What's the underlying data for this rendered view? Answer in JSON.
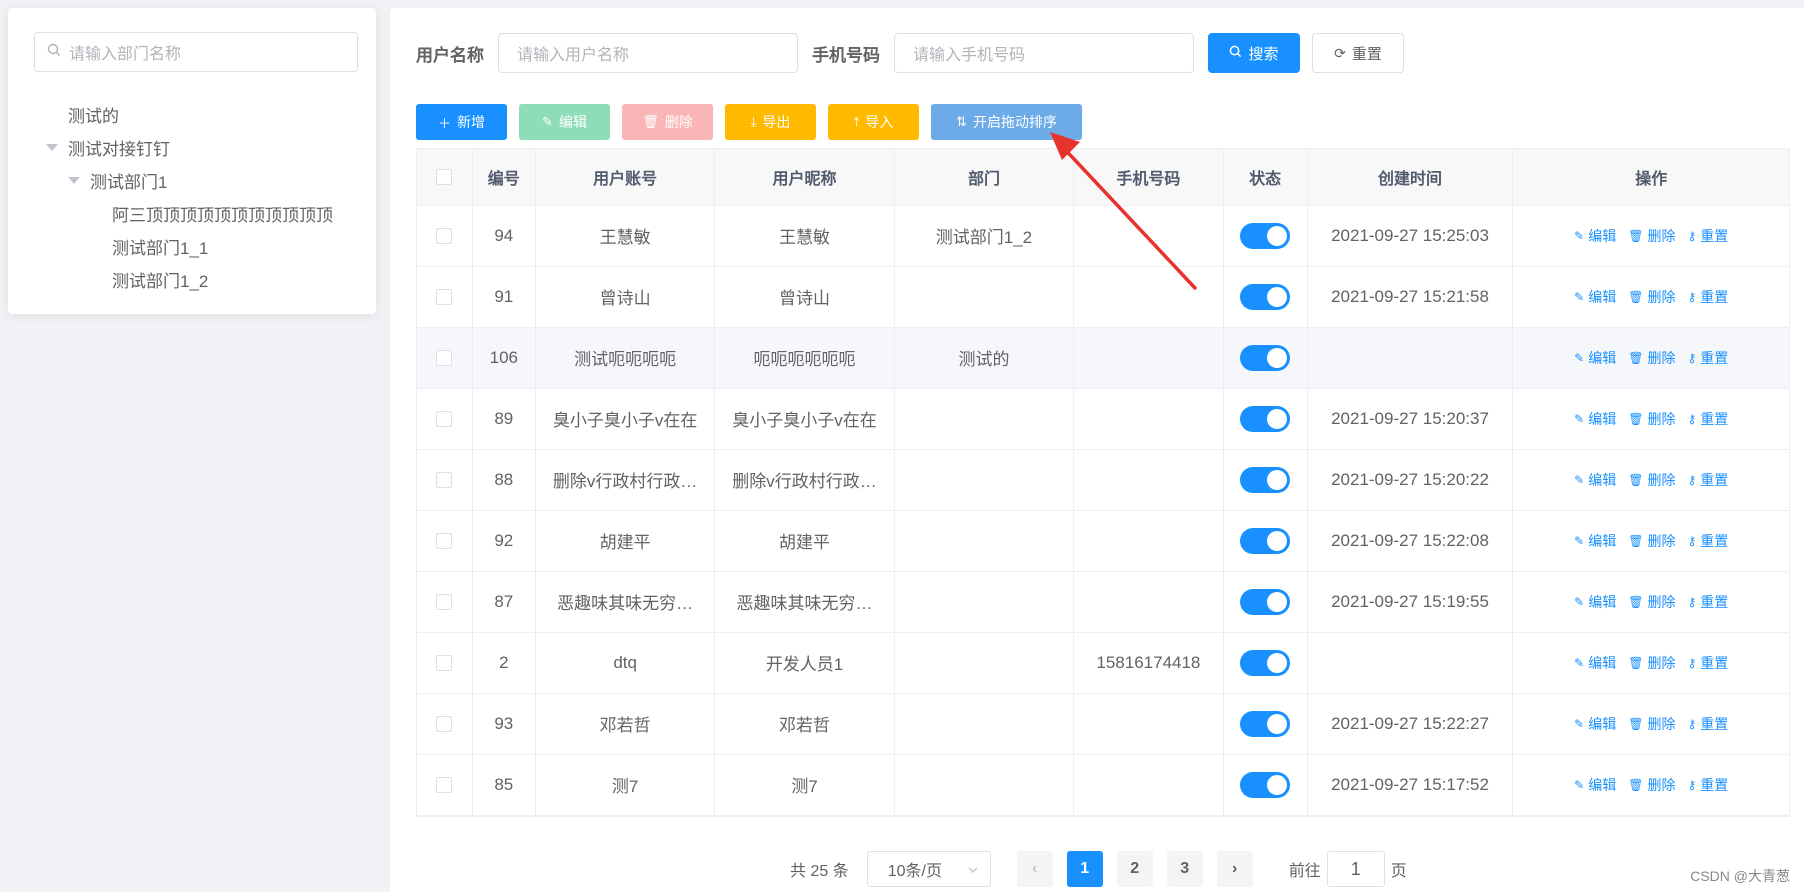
{
  "dept_panel": {
    "search_placeholder": "请输入部门名称",
    "tree": [
      {
        "label": "测试的",
        "level": 0,
        "expanded": false
      },
      {
        "label": "测试对接钉钉",
        "level": 0,
        "expanded": true
      },
      {
        "label": "测试部门1",
        "level": 1,
        "expanded": true
      },
      {
        "label": "阿三顶顶顶顶顶顶顶顶顶顶顶",
        "level": 2,
        "expanded": false
      },
      {
        "label": "测试部门1_1",
        "level": 2,
        "expanded": false
      },
      {
        "label": "测试部门1_2",
        "level": 2,
        "expanded": false
      }
    ]
  },
  "search_form": {
    "username_label": "用户名称",
    "username_placeholder": "请输入用户名称",
    "phone_label": "手机号码",
    "phone_placeholder": "请输入手机号码",
    "search_button": "搜索",
    "reset_button": "重置"
  },
  "toolbar": {
    "add": "新增",
    "edit": "编辑",
    "delete": "删除",
    "export": "导出",
    "import": "导入",
    "sort": "开启拖动排序"
  },
  "table": {
    "columns": [
      "",
      "编号",
      "用户账号",
      "用户昵称",
      "部门",
      "手机号码",
      "状态",
      "创建时间",
      "操作"
    ],
    "row_actions": {
      "edit": "编辑",
      "delete": "删除",
      "reset": "重置"
    },
    "rows": [
      {
        "id": "94",
        "account": "王慧敏",
        "nickname": "王慧敏",
        "dept": "测试部门1_2",
        "phone": "",
        "status": true,
        "created": "2021-09-27 15:25:03"
      },
      {
        "id": "91",
        "account": "曾诗山",
        "nickname": "曾诗山",
        "dept": "",
        "phone": "",
        "status": true,
        "created": "2021-09-27 15:21:58"
      },
      {
        "id": "106",
        "account": "测试呃呃呃呃",
        "nickname": "呃呃呃呃呃呃",
        "dept": "测试的",
        "phone": "",
        "status": true,
        "created": "",
        "highlight": true
      },
      {
        "id": "89",
        "account": "臭小子臭小子v在在",
        "nickname": "臭小子臭小子v在在",
        "dept": "",
        "phone": "",
        "status": true,
        "created": "2021-09-27 15:20:37"
      },
      {
        "id": "88",
        "account": "删除v行政村行政…",
        "nickname": "删除v行政村行政…",
        "dept": "",
        "phone": "",
        "status": true,
        "created": "2021-09-27 15:20:22"
      },
      {
        "id": "92",
        "account": "胡建平",
        "nickname": "胡建平",
        "dept": "",
        "phone": "",
        "status": true,
        "created": "2021-09-27 15:22:08"
      },
      {
        "id": "87",
        "account": "恶趣味其味无穷…",
        "nickname": "恶趣味其味无穷…",
        "dept": "",
        "phone": "",
        "status": true,
        "created": "2021-09-27 15:19:55"
      },
      {
        "id": "2",
        "account": "dtq",
        "nickname": "开发人员1",
        "dept": "",
        "phone": "15816174418",
        "status": true,
        "created": ""
      },
      {
        "id": "93",
        "account": "邓若哲",
        "nickname": "邓若哲",
        "dept": "",
        "phone": "",
        "status": true,
        "created": "2021-09-27 15:22:27"
      },
      {
        "id": "85",
        "account": "测7",
        "nickname": "测7",
        "dept": "",
        "phone": "",
        "status": true,
        "created": "2021-09-27 15:17:52"
      }
    ]
  },
  "pagination": {
    "total_text": "共 25 条",
    "page_size": "10条/页",
    "pages": [
      "1",
      "2",
      "3"
    ],
    "current": "1",
    "goto_prefix": "前往",
    "goto_value": "1",
    "goto_suffix": "页"
  },
  "watermark": "CSDN @大青葱",
  "colors": {
    "primary": "#1890ff",
    "success_light": "#8fdcb8",
    "danger_light": "#fab6b6",
    "warning": "#ffba00",
    "sort_button": "#6cabe8",
    "annotation_arrow": "#e8322d"
  }
}
